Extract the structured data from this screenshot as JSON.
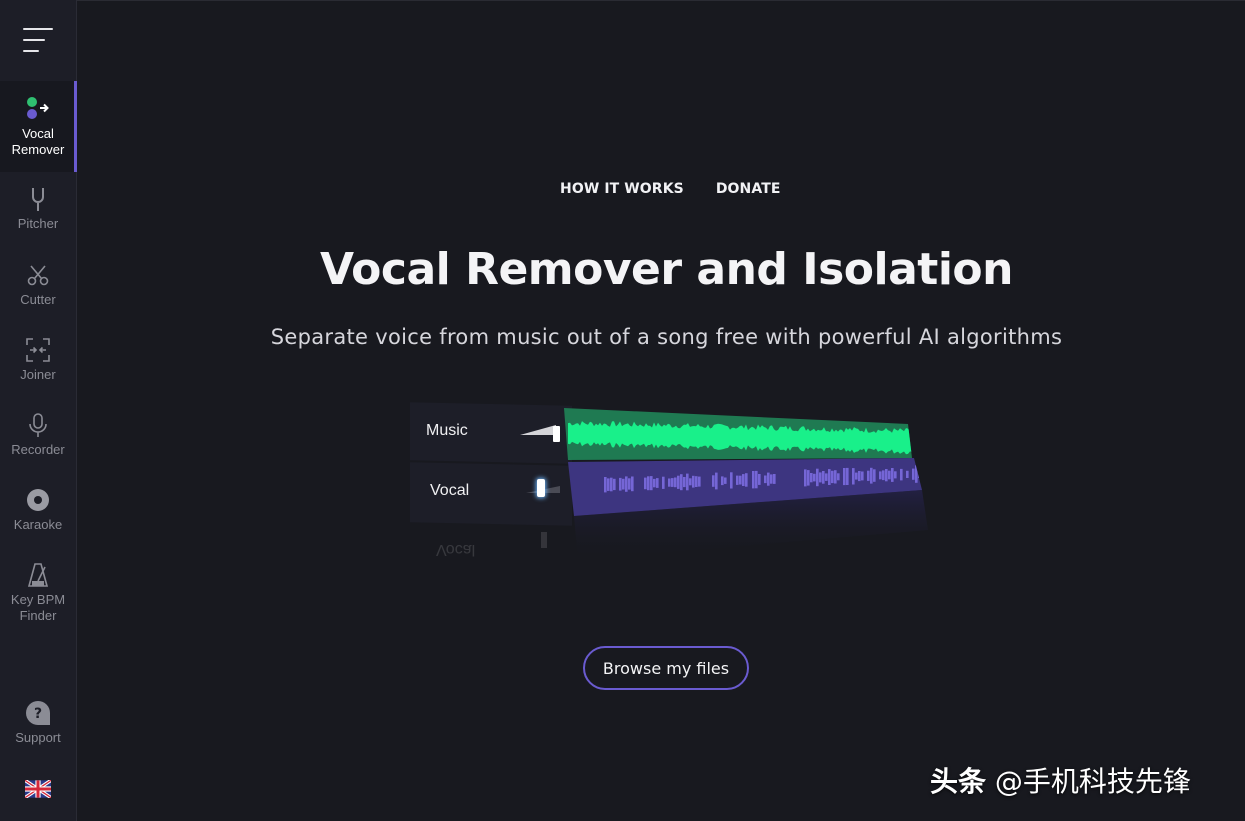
{
  "sidebar": {
    "menu_icon": "hamburger-menu-icon",
    "items": [
      {
        "id": "vocal-remover",
        "label_line1": "Vocal",
        "label_line2": "Remover",
        "icon": "vocal-remover-icon",
        "active": true
      },
      {
        "id": "pitcher",
        "label_line1": "Pitcher",
        "label_line2": "",
        "icon": "tuning-fork-icon",
        "active": false
      },
      {
        "id": "cutter",
        "label_line1": "Cutter",
        "label_line2": "",
        "icon": "scissors-icon",
        "active": false
      },
      {
        "id": "joiner",
        "label_line1": "Joiner",
        "label_line2": "",
        "icon": "joiner-icon",
        "active": false
      },
      {
        "id": "recorder",
        "label_line1": "Recorder",
        "label_line2": "",
        "icon": "microphone-icon",
        "active": false
      },
      {
        "id": "karaoke",
        "label_line1": "Karaoke",
        "label_line2": "",
        "icon": "disc-icon",
        "active": false
      },
      {
        "id": "key-bpm-finder",
        "label_line1": "Key BPM",
        "label_line2": "Finder",
        "icon": "metronome-icon",
        "active": false
      }
    ],
    "support": {
      "label": "Support",
      "icon": "question-bubble-icon"
    },
    "language": {
      "icon": "uk-flag-icon"
    }
  },
  "topnav": {
    "how_it_works": "HOW IT WORKS",
    "donate": "DONATE"
  },
  "hero": {
    "title": "Vocal Remover and Isolation",
    "subtitle": "Separate voice from music out of a song free with powerful AI algorithms"
  },
  "illustration": {
    "tracks": [
      {
        "name": "Music",
        "volume": 1.0,
        "color": "#1f7a52",
        "wave_color": "#19f08a"
      },
      {
        "name": "Vocal",
        "volume": 0.3,
        "color": "#3d3580",
        "wave_color": "#7566d6"
      }
    ],
    "reflection_label": "Vocal"
  },
  "actions": {
    "browse_label": "Browse my files"
  },
  "colors": {
    "accent": "#6a5bd0",
    "background": "#18191f",
    "sidebar": "#1d1e27"
  },
  "watermark": {
    "brand": "头条",
    "handle": "@手机科技先锋"
  }
}
